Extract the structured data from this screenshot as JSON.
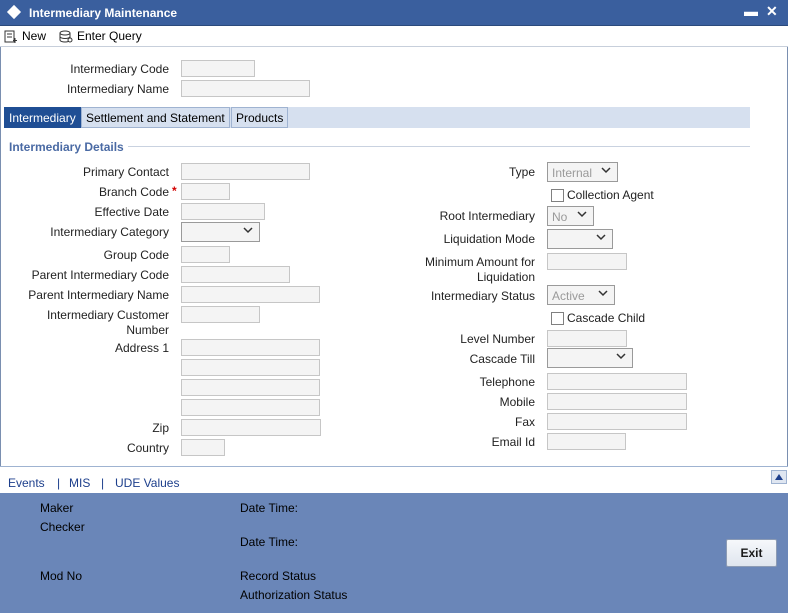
{
  "window": {
    "title": "Intermediary Maintenance",
    "minimize": "▬",
    "close": "✕"
  },
  "toolbar": {
    "new_label": "New",
    "enter_query_label": "Enter Query"
  },
  "header": {
    "code_label": "Intermediary Code",
    "name_label": "Intermediary Name"
  },
  "tabs": [
    {
      "label": "Intermediary",
      "active": true
    },
    {
      "label": "Settlement and Statement",
      "active": false
    },
    {
      "label": "Products",
      "active": false
    }
  ],
  "section": {
    "title": "Intermediary Details"
  },
  "left_fields": {
    "primary_contact": "Primary Contact",
    "branch_code": "Branch Code",
    "required_mark": "*",
    "effective_date": "Effective Date",
    "intermediary_category": "Intermediary Category",
    "group_code": "Group Code",
    "parent_code": "Parent Intermediary Code",
    "parent_name": "Parent Intermediary Name",
    "customer_number_line1": "Intermediary Customer",
    "customer_number_line2": "Number",
    "address1": "Address 1",
    "zip": "Zip",
    "country": "Country"
  },
  "right_fields": {
    "type": "Type",
    "type_value": "Internal",
    "collection_agent": "Collection Agent",
    "root_intermediary": "Root Intermediary",
    "root_value": "No",
    "liquidation_mode": "Liquidation Mode",
    "min_amount_line1": "Minimum Amount for",
    "min_amount_line2": "Liquidation",
    "status": "Intermediary Status",
    "status_value": "Active",
    "cascade_child": "Cascade Child",
    "level_number": "Level Number",
    "cascade_till": "Cascade Till",
    "telephone": "Telephone",
    "mobile": "Mobile",
    "fax": "Fax",
    "email": "Email Id"
  },
  "links": {
    "events": "Events",
    "mis": "MIS",
    "ude": "UDE Values",
    "separator": "|"
  },
  "footer": {
    "maker": "Maker",
    "checker": "Checker",
    "date_time_1": "Date Time:",
    "date_time_2": "Date Time:",
    "mod_no": "Mod No",
    "record_status": "Record Status",
    "authorization_status": "Authorization Status",
    "exit_label": "Exit"
  },
  "colors": {
    "titlebar": "#3a5f9e",
    "tab_active": "#1f4e94",
    "footer": "#6a86b8",
    "section_title": "#4a6aa4",
    "link": "#1d3f8c"
  }
}
